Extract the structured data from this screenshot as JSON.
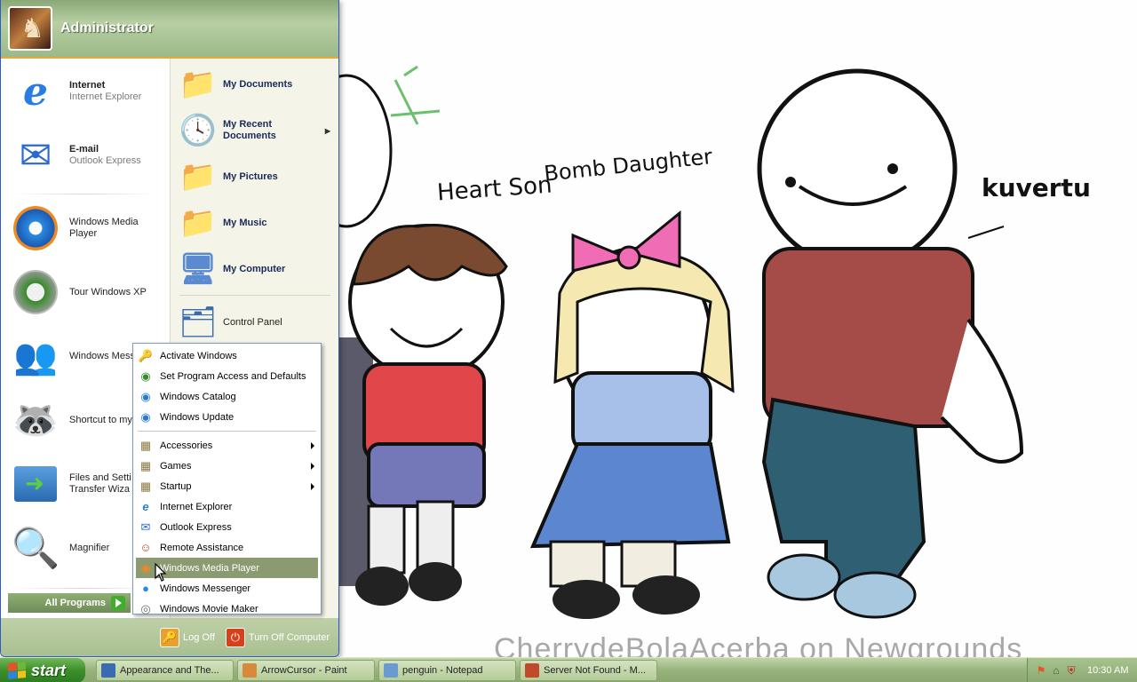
{
  "user": {
    "name": "Administrator"
  },
  "wallpaper": {
    "labels": [
      "Heart Son",
      "Bomb Daughter",
      "kuvertu"
    ],
    "watermark": "CherrydeBolaAcerba on Newgrounds"
  },
  "left_items": [
    {
      "title": "Internet",
      "subtitle": "Internet Explorer",
      "icon": "internet-explorer-icon"
    },
    {
      "title": "E-mail",
      "subtitle": "Outlook Express",
      "icon": "outlook-express-icon"
    },
    {
      "title": "Windows Media Player",
      "icon": "media-player-icon"
    },
    {
      "title": "Tour Windows XP",
      "icon": "tour-icon"
    },
    {
      "title": "Windows Mess",
      "icon": "messenger-icon"
    },
    {
      "title": "Shortcut to my",
      "icon": "raccoon-icon"
    },
    {
      "title": "Files and Setti Transfer Wiza",
      "icon": "transfer-wizard-icon"
    },
    {
      "title": "Magnifier",
      "icon": "magnifier-icon"
    }
  ],
  "all_programs_label": "All Programs",
  "right_items": [
    {
      "label": "My Documents",
      "icon": "folder-documents-icon"
    },
    {
      "label": "My Recent Documents",
      "icon": "recent-documents-icon"
    },
    {
      "label": "My Pictures",
      "icon": "folder-pictures-icon"
    },
    {
      "label": "My Music",
      "icon": "folder-music-icon"
    },
    {
      "label": "My Computer",
      "icon": "computer-icon"
    },
    {
      "label": "Control Panel",
      "icon": "control-panel-icon"
    }
  ],
  "footer": {
    "logoff_label": "Log Off",
    "turnoff_label": "Turn Off Computer"
  },
  "programs_menu": {
    "top_items": [
      {
        "label": "Activate Windows",
        "icon": "keys-icon"
      },
      {
        "label": "Set Program Access and Defaults",
        "icon": "program-access-icon"
      },
      {
        "label": "Windows Catalog",
        "icon": "catalog-icon"
      },
      {
        "label": "Windows Update",
        "icon": "update-icon"
      }
    ],
    "items": [
      {
        "label": "Accessories",
        "icon": "program-group-icon",
        "has_submenu": true
      },
      {
        "label": "Games",
        "icon": "program-group-icon",
        "has_submenu": true
      },
      {
        "label": "Startup",
        "icon": "program-group-icon",
        "has_submenu": true
      },
      {
        "label": "Internet Explorer",
        "icon": "internet-explorer-icon"
      },
      {
        "label": "Outlook Express",
        "icon": "outlook-express-icon"
      },
      {
        "label": "Remote Assistance",
        "icon": "remote-assistance-icon"
      },
      {
        "label": "Windows Media Player",
        "icon": "media-player-icon",
        "highlighted": true
      },
      {
        "label": "Windows Messenger",
        "icon": "messenger-icon"
      },
      {
        "label": "Windows Movie Maker",
        "icon": "movie-maker-icon"
      }
    ]
  },
  "taskbar": {
    "start_label": "start",
    "tasks": [
      {
        "label": "Appearance and The...",
        "icon": "control-panel-icon"
      },
      {
        "label": "ArrowCursor - Paint",
        "icon": "paint-icon"
      },
      {
        "label": "penguin - Notepad",
        "icon": "notepad-icon"
      },
      {
        "label": "Server Not Found - M...",
        "icon": "browser-icon"
      }
    ],
    "tray_icons": [
      "windows-flag-icon",
      "network-icon",
      "shield-icon"
    ],
    "clock": "10:30 AM"
  },
  "colors": {
    "theme_green": "#8aa870",
    "start_green": "#3c8f2a",
    "highlight": "#8b9a70"
  }
}
